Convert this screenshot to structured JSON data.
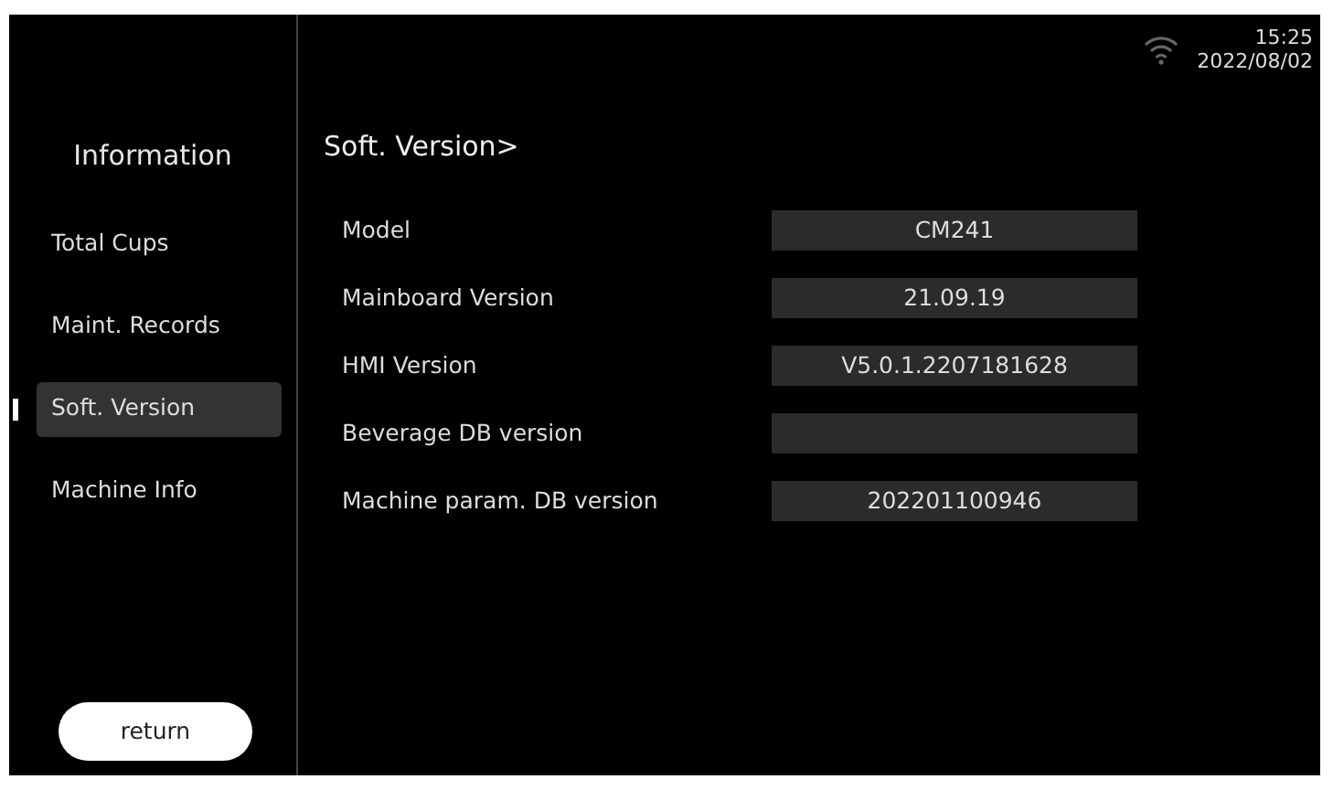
{
  "status_bar": {
    "time": "15:25",
    "date": "2022/08/02"
  },
  "sidebar": {
    "title": "Information",
    "items": [
      {
        "label": "Total Cups",
        "selected": false
      },
      {
        "label": "Maint. Records",
        "selected": false
      },
      {
        "label": "Soft. Version",
        "selected": true
      },
      {
        "label": "Machine Info",
        "selected": false
      }
    ],
    "return_button": "return"
  },
  "page": {
    "heading": "Soft. Version>",
    "rows": [
      {
        "label": "Model",
        "value": "CM241"
      },
      {
        "label": "Mainboard Version",
        "value": "21.09.19"
      },
      {
        "label": "HMI Version",
        "value": "V5.0.1.2207181628"
      },
      {
        "label": "Beverage DB version",
        "value": ""
      },
      {
        "label": "Machine param. DB version",
        "value": "202201100946"
      }
    ]
  }
}
